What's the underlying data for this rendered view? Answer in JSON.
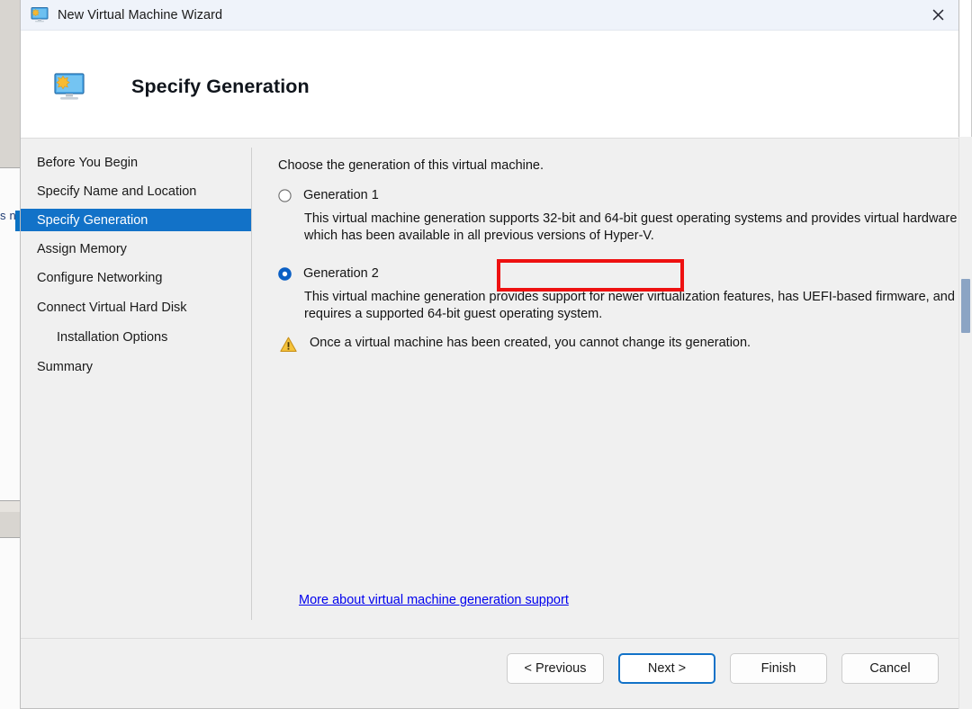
{
  "window": {
    "title": "New Virtual Machine Wizard",
    "icon": "virtual-machine-icon",
    "close_label": "✕"
  },
  "banner": {
    "title": "Specify Generation",
    "icon": "virtual-machine-icon"
  },
  "sidebar": {
    "items": [
      {
        "label": "Before You Begin",
        "active": false,
        "indent": false
      },
      {
        "label": "Specify Name and Location",
        "active": false,
        "indent": false
      },
      {
        "label": "Specify Generation",
        "active": true,
        "indent": false
      },
      {
        "label": "Assign Memory",
        "active": false,
        "indent": false
      },
      {
        "label": "Configure Networking",
        "active": false,
        "indent": false
      },
      {
        "label": "Connect Virtual Hard Disk",
        "active": false,
        "indent": false
      },
      {
        "label": "Installation Options",
        "active": false,
        "indent": true
      },
      {
        "label": "Summary",
        "active": false,
        "indent": false
      }
    ]
  },
  "content": {
    "intro": "Choose the generation of this virtual machine.",
    "options": [
      {
        "label": "Generation 1",
        "selected": false,
        "description": "This virtual machine generation supports 32-bit and 64-bit guest operating systems and provides virtual hardware which has been available in all previous versions of Hyper-V."
      },
      {
        "label": "Generation 2",
        "selected": true,
        "description": "This virtual machine generation provides support for newer virtualization features, has UEFI-based firmware, and requires a supported 64-bit guest operating system."
      }
    ],
    "warning": {
      "icon": "warning-triangle-icon",
      "text": "Once a virtual machine has been created, you cannot change its generation."
    },
    "more_link": "More about virtual machine generation support"
  },
  "footer": {
    "buttons": [
      {
        "label": "< Previous",
        "default": false
      },
      {
        "label": "Next >",
        "default": true
      },
      {
        "label": "Finish",
        "default": false
      },
      {
        "label": "Cancel",
        "default": false
      }
    ]
  },
  "background": {
    "left_text": "s no"
  },
  "colors": {
    "accent": "#1272c8",
    "highlight_box": "#ee1111",
    "link": "#0000ee",
    "warning": "#e8a317",
    "titlebar_bg": "#eff3fa",
    "body_bg": "#f0f0f0"
  }
}
